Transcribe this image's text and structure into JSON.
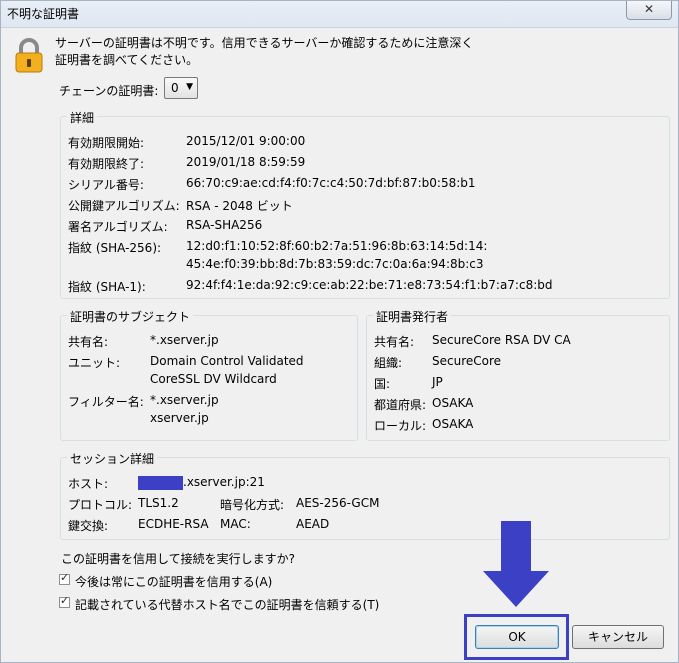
{
  "window": {
    "title": "不明な証明書",
    "close_glyph": "✕"
  },
  "message": {
    "line1": "サーバーの証明書は不明です。信用できるサーバーか確認するために注意深く",
    "line2": "証明書を調べてください。"
  },
  "chain": {
    "label": "チェーンの証明書:",
    "value": "0"
  },
  "details": {
    "title": "詳細",
    "rows": [
      {
        "label": "有効期限開始:",
        "value": "2015/12/01 9:00:00"
      },
      {
        "label": "有効期限終了:",
        "value": "2019/01/18 8:59:59"
      },
      {
        "label": "シリアル番号:",
        "value": "66:70:c9:ae:cd:f4:f0:7c:c4:50:7d:bf:87:b0:58:b1"
      },
      {
        "label": "公開鍵アルゴリズム:",
        "value": "RSA - 2048 ビット"
      },
      {
        "label": "署名アルゴリズム:",
        "value": "RSA-SHA256"
      },
      {
        "label": "指紋 (SHA-256):",
        "value": "12:d0:f1:10:52:8f:60:b2:7a:51:96:8b:63:14:5d:14:",
        "value2": "45:4e:f0:39:bb:8d:7b:83:59:dc:7c:0a:6a:94:8b:c3"
      },
      {
        "label": "指紋 (SHA-1):",
        "value": "92:4f:f4:1e:da:92:c9:ce:ab:22:be:71:e8:73:54:f1:b7:a7:c8:bd"
      }
    ]
  },
  "subject": {
    "title": "証明書のサブジェクト",
    "common_name_label": "共有名:",
    "common_name": "*.xserver.jp",
    "unit_label": "ユニット:",
    "unit1": "Domain Control Validated",
    "unit2": "CoreSSL DV Wildcard",
    "filter_label": "フィルター名:",
    "filter1": "*.xserver.jp",
    "filter2": "xserver.jp"
  },
  "issuer": {
    "title": "証明書発行者",
    "rows": [
      {
        "label": "共有名:",
        "value": "SecureCore RSA DV CA"
      },
      {
        "label": "組織:",
        "value": "SecureCore"
      },
      {
        "label": "国:",
        "value": "JP"
      },
      {
        "label": "都道府県:",
        "value": "OSAKA"
      },
      {
        "label": "ローカル:",
        "value": "OSAKA"
      }
    ]
  },
  "session": {
    "title": "セッション詳細",
    "host_label": "ホスト:",
    "host_suffix": ".xserver.jp:21",
    "protocol_label": "プロトコル:",
    "protocol": "TLS1.2",
    "cipher_label": "暗号化方式:",
    "cipher": "AES-256-GCM",
    "kex_label": "鍵交換:",
    "kex": "ECDHE-RSA",
    "mac_label": "MAC:",
    "mac": "AEAD"
  },
  "question": "この証明書を信用して接続を実行しますか?",
  "checkboxes": [
    {
      "label": "今後は常にこの証明書を信用する(A)",
      "checked": true
    },
    {
      "label": "記載されている代替ホスト名でこの証明書を信頼する(T)",
      "checked": true
    }
  ],
  "buttons": {
    "ok": "OK",
    "cancel": "キャンセル"
  },
  "colors": {
    "annotation": "#3c40c4",
    "lock_body": "#f2b01e"
  }
}
